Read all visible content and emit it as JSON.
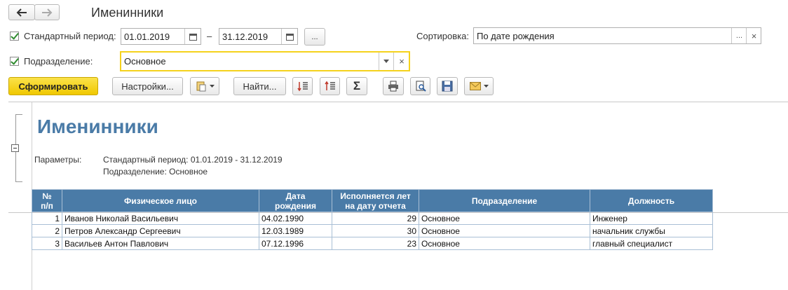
{
  "window": {
    "title": "Именинники"
  },
  "nav": {
    "back_icon": "arrow-left-icon",
    "forward_icon": "arrow-right-icon"
  },
  "filters": {
    "period_label": "Стандартный период:",
    "date_from": "01.01.2019",
    "date_separator": "–",
    "date_to": "31.12.2019",
    "more_label": "...",
    "sort_label": "Сортировка:",
    "sort_value": "По дате рождения",
    "sort_more": "...",
    "sort_clear": "×",
    "division_label": "Подразделение:",
    "division_value": "Основное",
    "division_clear": "×"
  },
  "toolbar": {
    "generate": "Сформировать",
    "settings": "Настройки...",
    "find": "Найти...",
    "sum_glyph": "Σ"
  },
  "report": {
    "title": "Именинники",
    "params_label": "Параметры:",
    "param_period": "Стандартный период: 01.01.2019 - 31.12.2019",
    "param_division": "Подразделение: Основное",
    "columns": [
      "№\nп/п",
      "Физическое лицо",
      "Дата\nрождения",
      "Исполняется лет\nна дату отчета",
      "Подразделение",
      "Должность"
    ],
    "rows": [
      [
        "1",
        "Иванов Николай Васильевич",
        "04.02.1990",
        "29",
        "Основное",
        "Инженер"
      ],
      [
        "2",
        "Петров Александр Сергеевич",
        "12.03.1989",
        "30",
        "Основное",
        "начальник службы"
      ],
      [
        "3",
        "Васильев Антон Павлович",
        "07.12.1996",
        "23",
        "Основное",
        "главный специалист"
      ]
    ]
  },
  "colors": {
    "accent_yellow": "#f5d21c",
    "header_blue": "#4a7ba7",
    "title_blue": "#4a7ba7"
  }
}
